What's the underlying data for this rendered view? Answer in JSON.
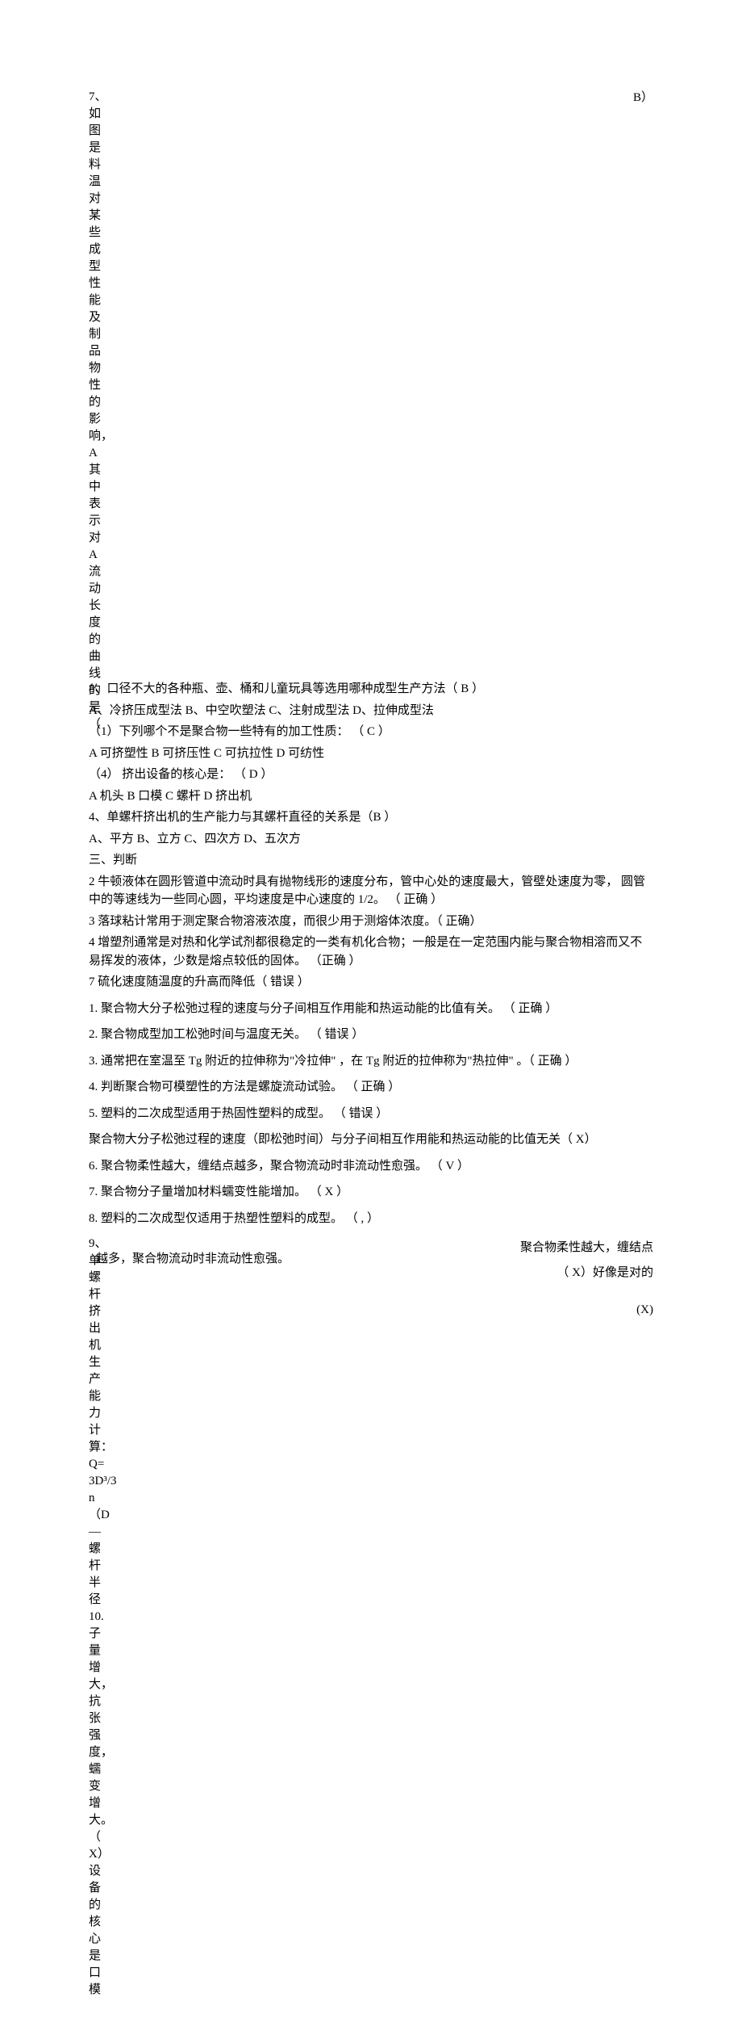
{
  "top": {
    "num": "7、如图是料温对某些成型性能及制品物性的影响，A其中表示对A流动长度的曲线的是（",
    "ans": "B）"
  },
  "midblock": [
    "8、口径不大的各种瓶、壶、桶和儿童玩具等选用哪种成型生产方法（ B ）",
    "A、冷挤压成型法 B、中空吹塑法  C、注射成型法 D、拉伸成型法",
    "（1）下列哪个不是聚合物一些特有的加工性质：   （ C ）",
    "A 可挤塑性 B 可挤压性 C 可抗拉性 D 可纺性",
    "（4） 挤出设备的核心是：  （ D ）",
    "A 机头 B 口模  C 螺杆 D 挤出机",
    "4、单螺杆挤出机的生产能力与其螺杆直径的关系是（B ）",
    "A、平方  B、立方  C、四次方  D、五次方",
    "三、判断",
    "2 牛顿液体在圆形管道中流动时具有抛物线形的速度分布，管中心处的速度最大，管壁处速度为零，   圆管中的等速线为一些同心圆，平均速度是中心速度的  1/2。  （ 正确 ）",
    "3 落球粘计常用于测定聚合物溶液浓度，而很少用于测熔体浓度。（  正确）",
    "4 增塑剂通常是对热和化学试剂都很稳定的一类有机化合物；一般是在一定范围内能与聚合物相溶而又不易挥发的液体，少数是熔点较低的固体。  （正确 ）",
    "7 硫化速度随温度的升高而降低（  错误  ）"
  ],
  "list1": [
    "1.  聚合物大分子松弛过程的速度与分子间相互作用能和热运动能的比值有关。  （ 正确  ）",
    "2.  聚合物成型加工松弛时间与温度无关。   （  错误  ）",
    "3.                                通常把在室温至  Tg 附近的拉伸称为\"冷拉伸\" ，在 Tg 附近的拉伸称为\"热拉伸\" 。（ 正确  ）",
    "4.  判断聚合物可模塑性的方法是螺旋流动试验。  （ 正确  ）",
    "5.  塑料的二次成型适用于热固性塑料的成型。   （  错误  ）",
    "聚合物大分子松弛过程的速度（即松弛时间）与分子间相互作用能和热运动能的比值无关（ X）",
    "6.  聚合物柔性越大，缠结点越多，聚合物流动时非流动性愈强。 （ V ）",
    "7.  聚合物分子量增加材料蠕变性能增加。 （ X ）",
    "8.  塑料的二次成型仅适用于热塑性塑料的成型。 （ ,  ）"
  ],
  "bottom": {
    "leftcol": "9、单螺杆挤出机生产能力计算：Q= 3D³/3 n （D—螺杆半径\n10.    子量增大，抗张强度，蠕变增大。（ X）设备的核心是口模",
    "left_line1": "越多，聚合物流动时非流动性愈强。",
    "left_vert": "9、挤：",
    "right_lines": [
      "聚合物柔性越大，缠结点",
      "（ X）好像是对的",
      "(X)"
    ]
  }
}
